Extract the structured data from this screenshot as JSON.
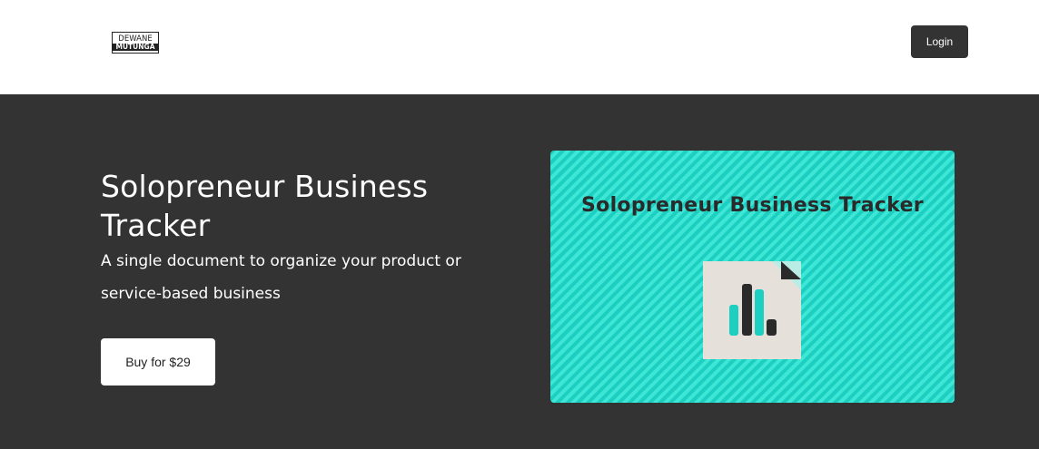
{
  "header": {
    "logo": {
      "line1": "DEWANE",
      "line2": "MUTUNGA"
    },
    "login_label": "Login"
  },
  "hero": {
    "title": "Solopreneur Business Tracker",
    "subtitle": "A single document to organize your product or service-based business",
    "buy_label": "Buy for $29"
  },
  "product_image": {
    "title": "Solopreneur Business Tracker",
    "icon": "document-bar-chart-icon",
    "colors": {
      "background": "#1ccfc0",
      "stripe": "#3ee6d6",
      "paper": "#e6e0da",
      "bar_teal": "#1ccfc0",
      "bar_dark": "#2a2a2a"
    }
  },
  "colors": {
    "hero_bg": "#333333",
    "header_bg": "#ffffff",
    "button_dark": "#333333",
    "button_light": "#ffffff"
  }
}
